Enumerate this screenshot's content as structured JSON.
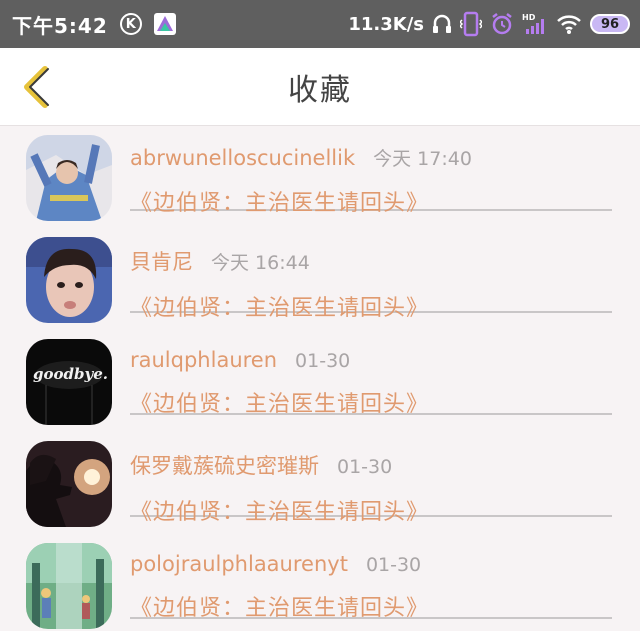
{
  "status_bar": {
    "time": "下午5:42",
    "k_badge": "K",
    "net_speed": "11.3K/s",
    "battery": "96"
  },
  "header": {
    "title": "收藏"
  },
  "items": [
    {
      "user": "abrwunelloscucinellik",
      "time": "今天 17:40",
      "title": "《边伯贤：主治医生请回头》"
    },
    {
      "user": "貝肯尼",
      "time": "今天 16:44",
      "title": "《边伯贤：主治医生请回头》"
    },
    {
      "user": "raulqphlauren",
      "time": "01-30",
      "title": "《边伯贤：主治医生请回头》"
    },
    {
      "user": "保罗戴蔟硫史密璀斯",
      "time": "01-30",
      "title": "《边伯贤：主治医生请回头》"
    },
    {
      "user": "polojraulphlaaurenyt",
      "time": "01-30",
      "title": "《边伯贤：主治医生请回头》"
    }
  ],
  "colors": {
    "accent": "#e09a6f",
    "back_arrow": "#e6c23a",
    "status_bg": "#5f5f5f"
  }
}
